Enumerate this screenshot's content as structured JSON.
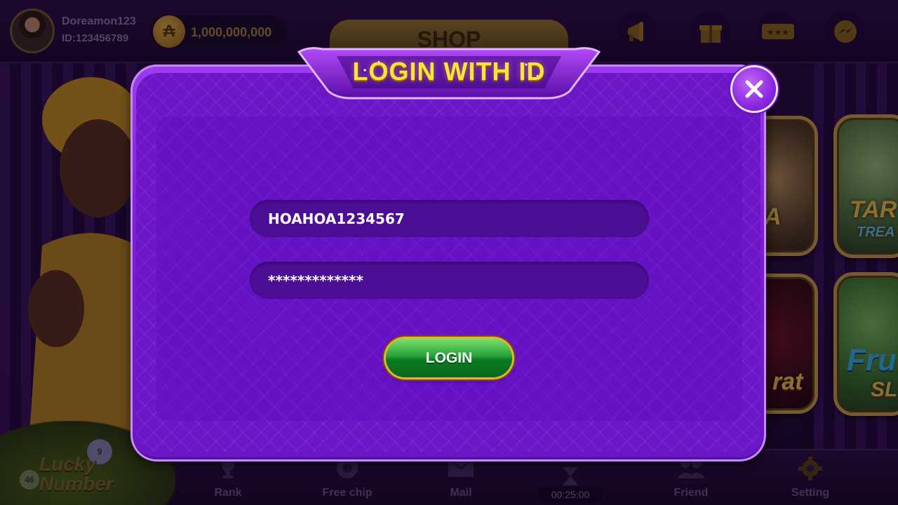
{
  "header": {
    "username": "Doreamon123",
    "user_id": "ID:123456789",
    "coin_symbol": "₳",
    "coins": "1,000,000,000",
    "shop_label": "SHOP",
    "icons": [
      "megaphone-icon",
      "gift-icon",
      "ticket-icon",
      "messenger-icon"
    ]
  },
  "games": {
    "tile1_text": "A",
    "tile2_text": "TAR",
    "tile2_sub": "TREA",
    "tile3_text": "rat",
    "tile4_text": "Fru",
    "tile4_sub": "SL"
  },
  "bottom_nav": {
    "lucky_line1": "Lucky",
    "lucky_line2": "Number",
    "ball_numbers": [
      "9",
      "46"
    ],
    "items": [
      {
        "label": "Rank",
        "icon": "trophy-icon"
      },
      {
        "label": "Free chip",
        "icon": "chip-icon"
      },
      {
        "label": "Mail",
        "icon": "mail-icon"
      },
      {
        "label": "Friend",
        "icon": "friends-icon"
      },
      {
        "label": "Setting",
        "icon": "gear-icon"
      }
    ],
    "timer": "00:25:00"
  },
  "modal": {
    "title": "LOGIN WITH ID",
    "username_value": "HOAHOA1234567",
    "password_display": "*************",
    "login_label": "LOGIN"
  },
  "colors": {
    "modal_purple": "#7a1fd8",
    "title_gold": "#ffe23a",
    "login_green": "#25a23a"
  }
}
